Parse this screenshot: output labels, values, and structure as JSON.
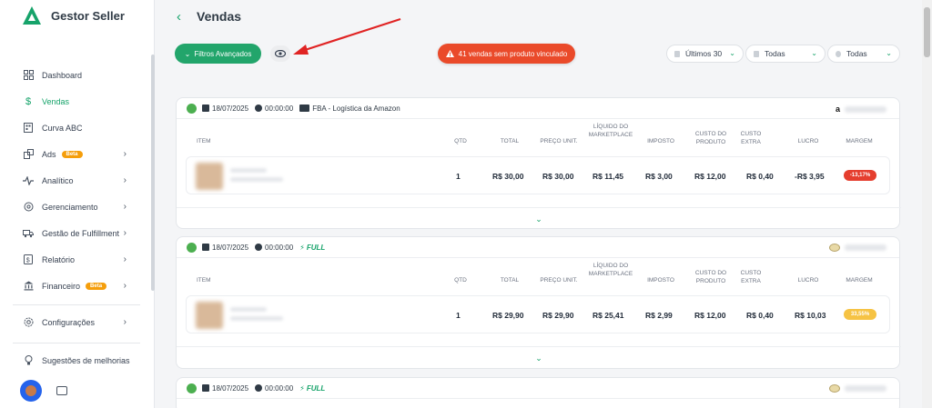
{
  "brand": {
    "name": "Gestor Seller",
    "logo_color": "#16a36a"
  },
  "sidebar": {
    "items": [
      {
        "label": "Dashboard",
        "icon": "grid-icon",
        "chevron": false,
        "badge": ""
      },
      {
        "label": "Vendas",
        "icon": "dollar-icon",
        "chevron": false,
        "badge": "",
        "active": true
      },
      {
        "label": "Curva ABC",
        "icon": "building-icon",
        "chevron": false,
        "badge": ""
      },
      {
        "label": "Ads",
        "icon": "ads-icon",
        "chevron": true,
        "badge": "Beta"
      },
      {
        "label": "Analítico",
        "icon": "pulse-icon",
        "chevron": true,
        "badge": ""
      },
      {
        "label": "Gerenciamento",
        "icon": "gear-icon",
        "chevron": true,
        "badge": ""
      },
      {
        "label": "Gestão de Fulfillment",
        "icon": "truck-icon",
        "chevron": true,
        "badge": ""
      },
      {
        "label": "Relatório",
        "icon": "dollar-doc-icon",
        "chevron": true,
        "badge": ""
      },
      {
        "label": "Financeiro",
        "icon": "bank-icon",
        "chevron": true,
        "badge": "Beta"
      }
    ],
    "settings": {
      "label": "Configurações",
      "icon": "settings-icon"
    },
    "suggestions": {
      "label": "Sugestões de melhorias",
      "icon": "bulb-icon"
    }
  },
  "header": {
    "title": "Vendas",
    "filters_label": "Filtros Avançados",
    "alert_label": "41 vendas sem produto vinculado",
    "period": "Últimos 30",
    "filter_2": "Todas",
    "filter_3": "Todas",
    "accent": "#22a56b",
    "alert_color": "#ea4a2a"
  },
  "columns": {
    "item": "ITEM",
    "qtd": "QTD",
    "total": "TOTAL",
    "preco": "PREÇO UNIT.",
    "liquido": "LÍQUIDO DO MARKETPLACE",
    "imposto": "IMPOSTO",
    "custo_produto": "CUSTO DO PRODUTO",
    "custo_extra": "CUSTO EXTRA",
    "lucro": "LUCRO",
    "margem": "MARGEM"
  },
  "orders": [
    {
      "date": "18/07/2025",
      "time": "00:00:00",
      "shipping": "FBA - Logística da Amazon",
      "full": "",
      "marketplace_icon": "amazon-icon",
      "qtd": "1",
      "total": "R$ 30,00",
      "preco": "R$ 30,00",
      "liquido": "R$ 11,45",
      "imposto": "R$ 3,00",
      "custo_produto": "R$ 12,00",
      "custo_extra": "R$ 0,40",
      "lucro": "-R$ 3,95",
      "margem": "-13,17%",
      "margem_color": "#e53e2e"
    },
    {
      "date": "18/07/2025",
      "time": "00:00:00",
      "shipping": "",
      "full": "FULL",
      "marketplace_icon": "mercadolivre-icon",
      "qtd": "1",
      "total": "R$ 29,90",
      "preco": "R$ 29,90",
      "liquido": "R$ 25,41",
      "imposto": "R$ 2,99",
      "custo_produto": "R$ 12,00",
      "custo_extra": "R$ 0,40",
      "lucro": "R$ 10,03",
      "margem": "33,55%",
      "margem_color": "#f6c344"
    },
    {
      "date": "18/07/2025",
      "time": "00:00:00",
      "shipping": "",
      "full": "FULL",
      "marketplace_icon": "mercadolivre-icon"
    }
  ]
}
